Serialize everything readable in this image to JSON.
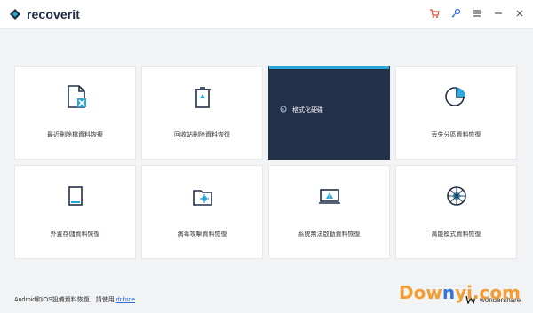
{
  "app": {
    "logo_text": "recoverit"
  },
  "cards": [
    {
      "label": "最近刪除檔資料恢復",
      "icon": "deleted-file-icon"
    },
    {
      "label": "回收站刪除資料恢復",
      "icon": "recycle-bin-icon"
    },
    {
      "label": "格式化硬碟",
      "icon": "info-icon",
      "active": true
    },
    {
      "label": "丟失分區資料恢復",
      "icon": "partition-icon"
    },
    {
      "label": "外置存儲資料恢復",
      "icon": "external-storage-icon"
    },
    {
      "label": "病毒攻擊資料恢復",
      "icon": "virus-folder-icon"
    },
    {
      "label": "系統無法啟動資料恢復",
      "icon": "laptop-warning-icon"
    },
    {
      "label": "萬能模式資料恢復",
      "icon": "all-around-icon"
    }
  ],
  "footer": {
    "text": "Android和iOS設備資料恢復，請使用",
    "link": "dr.fone"
  },
  "brand": "wondershare",
  "watermark": {
    "left": "Dow",
    "y": "n",
    "right": "yi.com"
  },
  "colors": {
    "accent": "#27a6d8",
    "active_bg": "#23304a",
    "cart": "#e04a3a",
    "key": "#2a6edb"
  }
}
